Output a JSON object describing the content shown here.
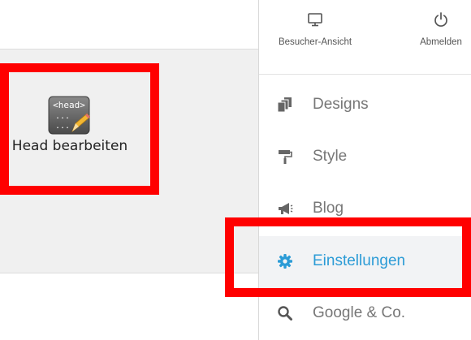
{
  "editor": {
    "head_tile": {
      "icon_text": "<head>",
      "icon_dots": "...",
      "label": "Head bearbeiten"
    }
  },
  "sidebar": {
    "top_actions": [
      {
        "label": "Besucher-Ansicht",
        "icon": "monitor-icon"
      },
      {
        "label": "Abmelden",
        "icon": "power-icon"
      }
    ],
    "nav": [
      {
        "label": "Designs",
        "icon": "layers-icon",
        "active": false
      },
      {
        "label": "Style",
        "icon": "paint-roller-icon",
        "active": false
      },
      {
        "label": "Blog",
        "icon": "megaphone-icon",
        "active": false
      },
      {
        "label": "Einstellungen",
        "icon": "gear-icon",
        "active": true
      },
      {
        "label": "Google & Co.",
        "icon": "search-icon",
        "active": false
      }
    ]
  },
  "colors": {
    "accent": "#2b9bd6",
    "highlight": "#ff0000",
    "text_muted": "#777777"
  }
}
